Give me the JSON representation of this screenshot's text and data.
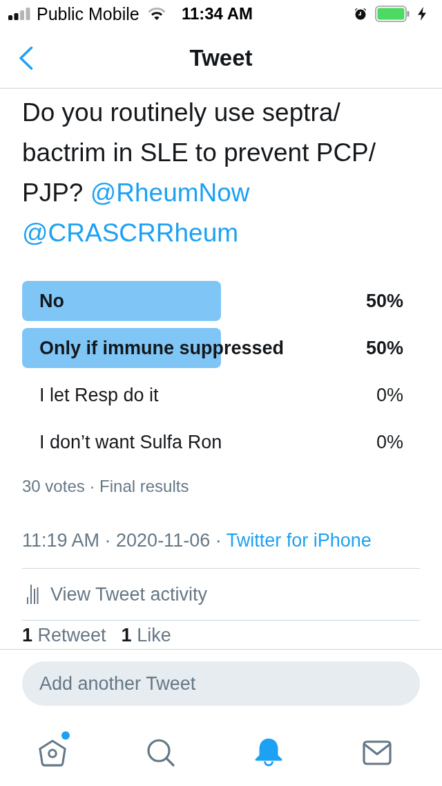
{
  "status_bar": {
    "carrier": "Public Mobile",
    "time": "11:34 AM"
  },
  "header": {
    "title": "Tweet"
  },
  "tweet": {
    "text": "Do you routinely use septra/bactrim in SLE to prevent PCP/PJP?",
    "mentions": [
      "@RheumNow",
      "@CRASCRRheum"
    ]
  },
  "poll": {
    "options": [
      {
        "label": "No",
        "reading": "50%",
        "level": 0.5,
        "leading": true
      },
      {
        "label": "Only if immune suppressed",
        "reading": "50%",
        "level": 0.5,
        "leading": true
      },
      {
        "label": "I let Resp do it",
        "reading": "0%",
        "leading": false
      },
      {
        "label": "I don’t want Sulfa Ron",
        "reading": "0%",
        "leading": false
      }
    ],
    "summary": "30 votes · Final results"
  },
  "meta": {
    "timestamp": "11:19 AM · 2020-11-06 ·",
    "source": "Twitter for iPhone"
  },
  "activity": {
    "label": "View Tweet activity"
  },
  "stats": [
    "**1** Retweet",
    "**1** Like"
  ],
  "composer": {
    "placeholder": "Add another Tweet"
  },
  "tab_bar": {
    "tabs": [
      {
        "kind": "home",
        "selected": false,
        "unread": true
      },
      {
        "kind": "search",
        "selected": false,
        "unread": false
      },
      {
        "kind": "notifications",
        "selected": true,
        "unread": false
      },
      {
        "kind": "messages",
        "selected": false,
        "unread": false
      }
    ]
  }
}
